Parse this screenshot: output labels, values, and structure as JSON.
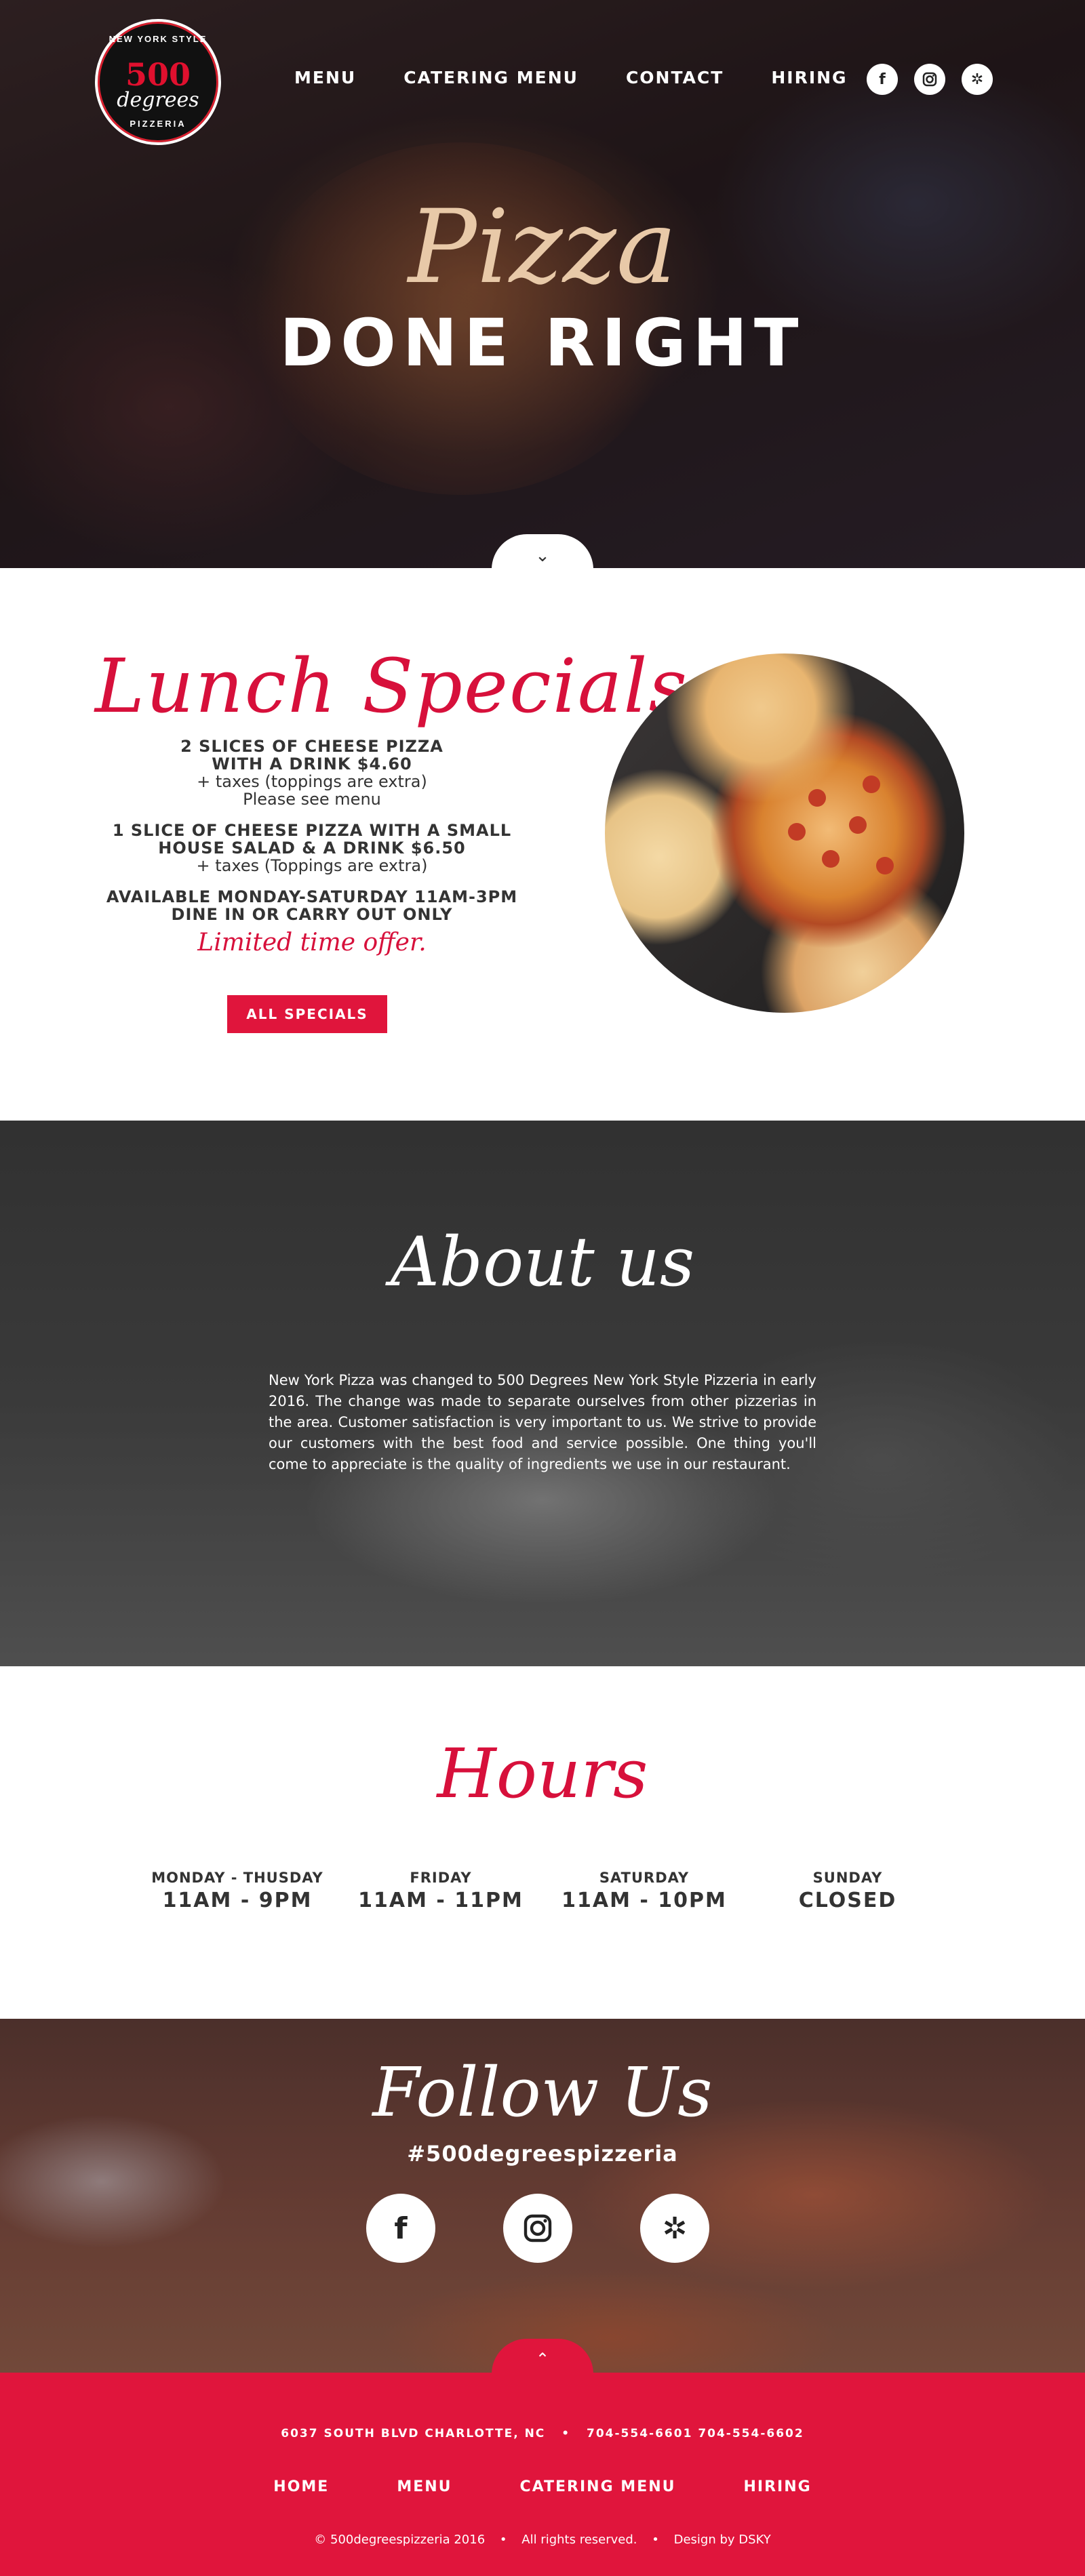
{
  "brand": {
    "logo_top": "NEW YORK STYLE",
    "logo_number": "500",
    "logo_word": "degrees",
    "logo_bottom": "PIZZERIA"
  },
  "nav": {
    "items": [
      "MENU",
      "CATERING MENU",
      "CONTACT",
      "HIRING"
    ]
  },
  "social_icons": [
    "facebook-icon",
    "instagram-icon",
    "yelp-icon"
  ],
  "hero": {
    "script_word": "Pizza",
    "headline": "DONE RIGHT",
    "scroll_icon": "chevron-down-icon"
  },
  "lunch": {
    "title": "Lunch Specials",
    "special1_line1": "2 SLICES OF CHEESE PIZZA",
    "special1_line2": "WITH A DRINK $4.60",
    "special1_line3": "+ taxes (toppings are extra)",
    "special1_line4": "Please see menu",
    "special2_line1": "1 SLICE OF CHEESE PIZZA WITH A SMALL",
    "special2_line2": "HOUSE SALAD & A DRINK $6.50",
    "special2_line3": "+ taxes (Toppings are extra)",
    "avail_line1": "AVAILABLE MONDAY-SATURDAY 11AM-3PM",
    "avail_line2": "DINE IN OR CARRY OUT ONLY",
    "offer": "Limited time offer.",
    "button": "ALL SPECIALS"
  },
  "about": {
    "title": "About us",
    "body": "New York Pizza was changed to 500 Degrees New York Style Pizzeria in early 2016. The change was made to separate ourselves from other pizzerias in the area. Customer satisfaction is very important to us. We strive to provide our customers with the best food and service possible. One thing you'll come to appreciate is the quality of ingredients we use in our restaurant."
  },
  "hours": {
    "title": "Hours",
    "days": [
      {
        "day": "MONDAY - THUSDAY",
        "time": "11AM - 9PM"
      },
      {
        "day": "FRIDAY",
        "time": "11AM - 11PM"
      },
      {
        "day": "SATURDAY",
        "time": "11AM - 10PM"
      },
      {
        "day": "SUNDAY",
        "time": "CLOSED"
      }
    ]
  },
  "follow": {
    "title": "Follow Us",
    "hashtag": "#500degreespizzeria",
    "up_icon": "chevron-up-icon"
  },
  "footer": {
    "address": "6037 SOUTH BLVD CHARLOTTE, NC",
    "phones": "704-554-6601  704-554-6602",
    "nav": [
      "HOME",
      "MENU",
      "CATERING MENU",
      "HIRING"
    ],
    "copyright": "© 500degreespizzeria 2016",
    "rights": "All rights reserved.",
    "design": "Design by DSKY"
  }
}
